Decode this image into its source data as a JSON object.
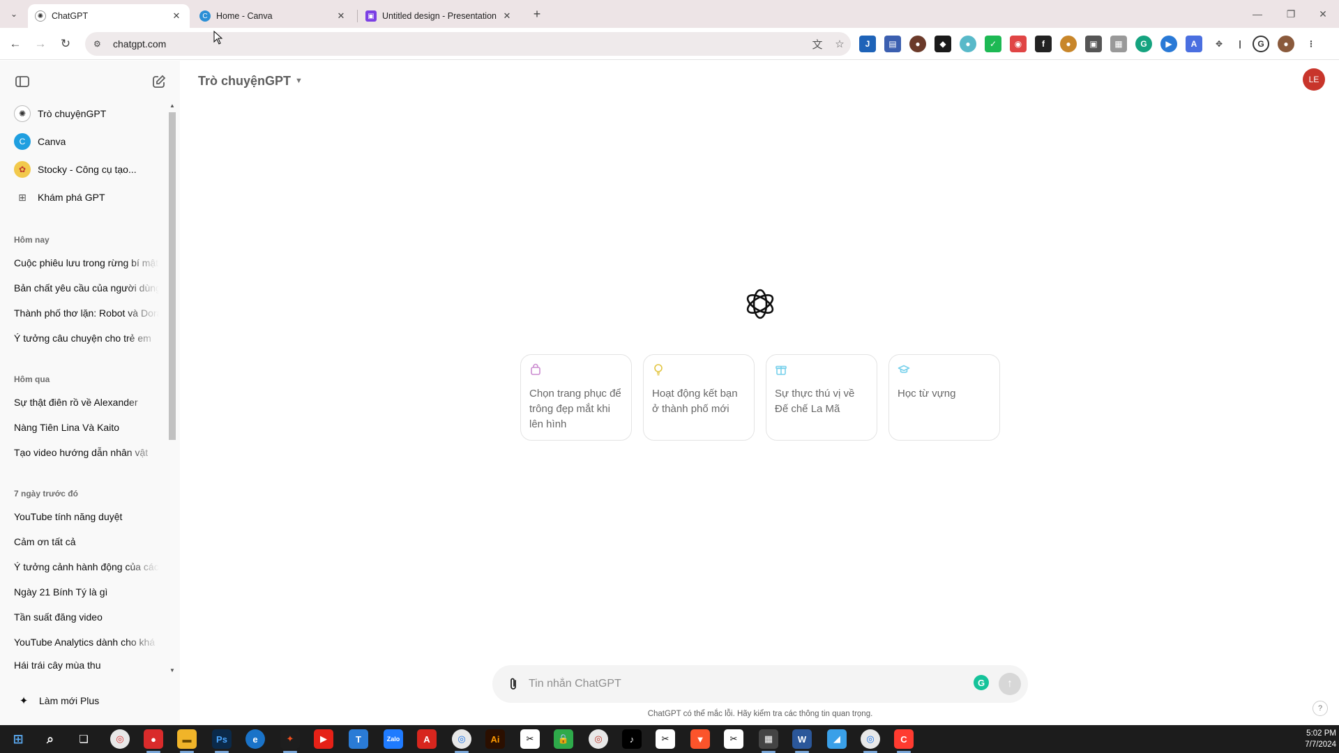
{
  "browser": {
    "tabs": [
      {
        "title": "ChatGPT",
        "active": true
      },
      {
        "title": "Home - Canva",
        "active": false
      },
      {
        "title": "Untitled design - Presentation",
        "active": false
      }
    ],
    "url": "chatgpt.com"
  },
  "sidebar": {
    "gpts": [
      {
        "label": "Trò chuyệnGPT",
        "icon": "openai-icon"
      },
      {
        "label": "Canva",
        "icon": "canva-icon"
      },
      {
        "label": "Stocky - Công cụ tạo...",
        "icon": "stocky-icon"
      },
      {
        "label": "Khám phá GPT",
        "icon": "grid-icon"
      }
    ],
    "sections": [
      {
        "heading": "Hôm nay",
        "items": [
          "Cuộc phiêu lưu trong rừng bí mật",
          "Bản chất yêu cầu của người dùng",
          "Thành phố thơ lặn: Robot và Dora",
          "Ý tưởng câu chuyện cho trẻ em"
        ]
      },
      {
        "heading": "Hôm qua",
        "items": [
          "Sự thật điên rồ về Alexander",
          "Nàng Tiên Lina Và Kaito",
          "Tạo video hướng dẫn nhân vật"
        ]
      },
      {
        "heading": "7 ngày trước đó",
        "items": [
          "YouTube tính năng duyệt",
          "Cảm ơn tất cả",
          "Ý tưởng cảnh hành động của các",
          "Ngày 21 Bính Tý là gì",
          "Tần suất đăng video",
          "YouTube Analytics dành cho khá",
          "Hái trái cây mùa thu"
        ]
      }
    ],
    "upgrade_label": "Làm mới Plus"
  },
  "main": {
    "model_label": "Trò chuyệnGPT",
    "avatar_initials": "LE",
    "suggestions": [
      {
        "text": "Chọn trang phục để trông đẹp mắt khi lên hình",
        "icon": "shopping-bag-icon",
        "color": "#cb8bd0"
      },
      {
        "text": "Hoạt động kết bạn ở thành phố mới",
        "icon": "lightbulb-icon",
        "color": "#e2c541"
      },
      {
        "text": "Sự thực thú vị về Đế chế La Mã",
        "icon": "gift-icon",
        "color": "#76d0eb"
      },
      {
        "text": "Học từ vựng",
        "icon": "graduation-cap-icon",
        "color": "#76d0eb"
      }
    ],
    "composer_placeholder": "Tin nhắn ChatGPT",
    "disclaimer": "ChatGPT có thể mắc lỗi. Hãy kiểm tra các thông tin quan trọng."
  },
  "taskbar": {
    "time": "5:02 PM",
    "date": "7/7/2024"
  }
}
